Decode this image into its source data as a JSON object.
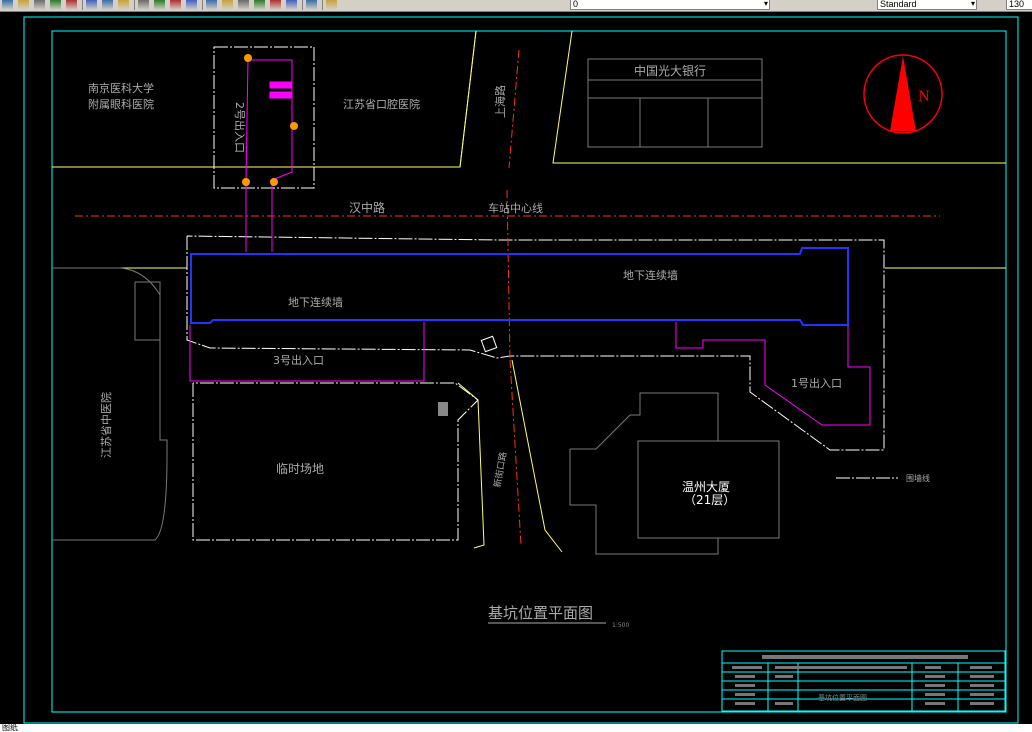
{
  "toolbar": {
    "layer_value": "0",
    "style_value": "Standard",
    "zoom_value": "130",
    "icons": [
      "open-icon",
      "save-icon",
      "print-icon",
      "pen-icon",
      "brush-icon",
      "arrow-down-icon",
      "move-icon",
      "undo-icon",
      "pan-icon",
      "zoom-realtime-icon",
      "zoom-window-icon",
      "zoom-previous-icon",
      "properties-icon",
      "design-center-icon",
      "tool-palette-icon",
      "sheet-icon",
      "markup-icon",
      "calculator-icon",
      "help-icon",
      "layer-manager-icon",
      "layer-state-icon",
      "lightbulb-icon",
      "sun-icon",
      "lock-icon",
      "color-icon",
      "layer-previous-icon",
      "text-style-icon"
    ]
  },
  "drawing": {
    "title": "基坑位置平面图",
    "scale": "1:500",
    "north_label": "N",
    "labels": {
      "hospital": "南京医科大学",
      "hospital2": "附属眼科医院",
      "stomatology": "江苏省口腔医院",
      "bank": "中国光大银行",
      "road_north": "上海路",
      "road_main": "汉中路",
      "station_center": "车站中心线",
      "wall1": "地下连续墙",
      "wall2": "地下连续墙",
      "exit1": "1号出入口",
      "exit2": "2号出入口",
      "exit3": "3号出入口",
      "tcm_hospital": "江苏省中医院",
      "temp_site": "临时场地",
      "tower_name": "温州大厦",
      "tower_floors": "（21层）",
      "fence_line": "围墙线",
      "road_south": "新街口路",
      "drawing_name": "基坑位置平面图"
    }
  },
  "status": {
    "command_prompt": "图纸"
  },
  "colors": {
    "background": "#000000",
    "frame": "#00ffff",
    "road": "#ffff66",
    "white": "#ffffff",
    "blue_wall": "#2233ff",
    "magenta": "#ff00ff",
    "red_dash": "#ff3300",
    "gray_text": "#aaaaaa"
  }
}
